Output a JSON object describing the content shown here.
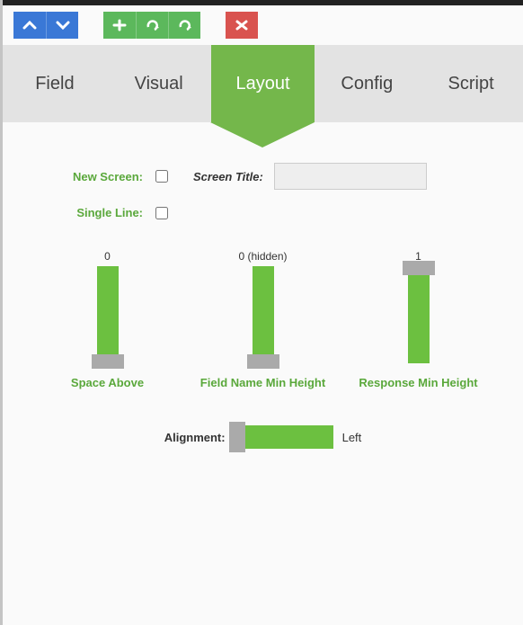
{
  "toolbar": {
    "groups": [
      {
        "color": "blue",
        "icons": [
          "chevron-up-icon",
          "chevron-down-icon"
        ]
      },
      {
        "color": "green",
        "icons": [
          "plus-icon",
          "redo-icon",
          "share-icon"
        ]
      },
      {
        "color": "red",
        "icons": [
          "close-icon"
        ]
      }
    ]
  },
  "tabs": [
    "Field",
    "Visual",
    "Layout",
    "Config",
    "Script"
  ],
  "activeTab": 2,
  "form": {
    "newScreen": {
      "label": "New Screen:",
      "checked": false
    },
    "screenTitle": {
      "label": "Screen Title:",
      "value": ""
    },
    "singleLine": {
      "label": "Single Line:",
      "checked": false
    }
  },
  "sliders": [
    {
      "value": "0",
      "caption": "Space Above",
      "handlePos": "bottom"
    },
    {
      "value": "0 (hidden)",
      "caption": "Field Name Min Height",
      "handlePos": "bottom"
    },
    {
      "value": "1",
      "caption": "Response Min Height",
      "handlePos": "top"
    }
  ],
  "alignment": {
    "label": "Alignment:",
    "value": "Left"
  }
}
